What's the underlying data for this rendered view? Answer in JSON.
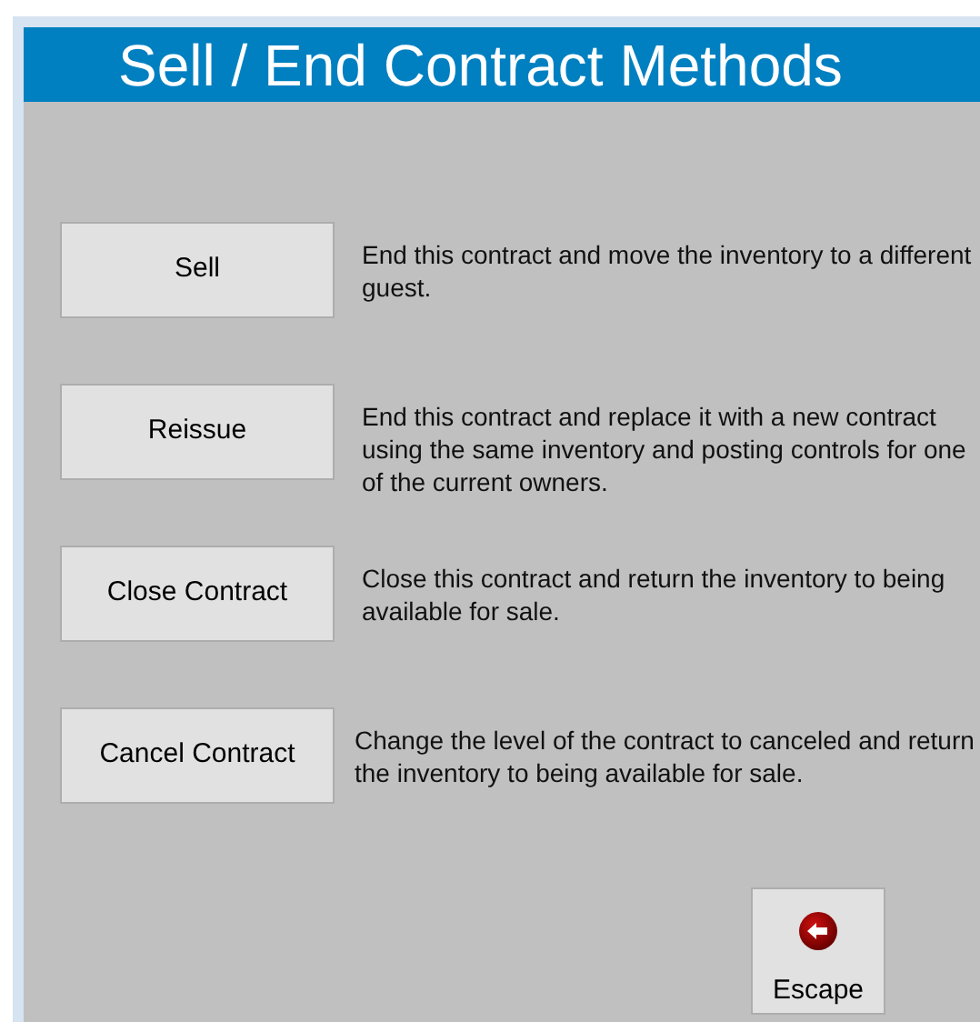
{
  "title": "Sell / End Contract Methods",
  "methods": [
    {
      "label": "Sell",
      "description": "End this contract and move the inventory to a different guest."
    },
    {
      "label": "Reissue",
      "description": "End this contract and replace it with a new contract using the same inventory and posting controls for one of the current owners."
    },
    {
      "label": "Close Contract",
      "description": "Close this contract and return the inventory to being available for sale."
    },
    {
      "label": "Cancel Contract",
      "description": "Change the level of the contract to canceled and return the inventory to being available for sale."
    }
  ],
  "escape_button": {
    "label": "Escape"
  }
}
